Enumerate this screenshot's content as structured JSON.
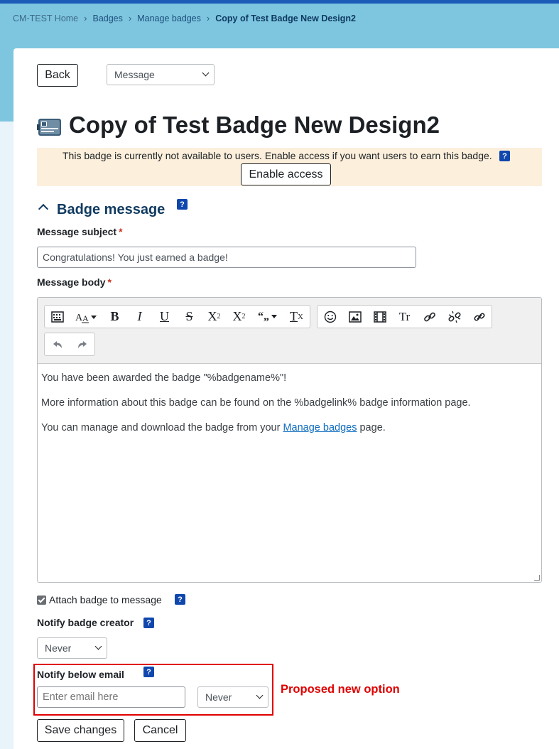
{
  "breadcrumb": {
    "home": "CM-TEST Home",
    "badges": "Badges",
    "manage": "Manage badges",
    "current": "Copy of Test Badge New Design2",
    "separator": "›"
  },
  "actions": {
    "back_label": "Back",
    "view_select": "Message"
  },
  "page": {
    "title": "Copy of Test Badge New Design2"
  },
  "notice": {
    "text": "This badge is currently not available to users. Enable access if you want users to earn this badge.",
    "enable_label": "Enable access"
  },
  "section": {
    "title": "Badge message"
  },
  "form": {
    "subject_label": "Message subject",
    "subject_value": "Congratulations! You just earned a badge!",
    "body_label": "Message body",
    "required_mark": "*",
    "help_mark": "?",
    "body_paragraph1": "You have been awarded the badge \"%badgename%\"!",
    "body_paragraph2": "More information about this badge can be found on the %badgelink% badge information page.",
    "body_paragraph3_prefix": "You can manage and download the badge from your ",
    "body_link": "Manage badges",
    "body_paragraph3_suffix": " page.",
    "attach_label": "Attach badge to message",
    "attach_checked": true,
    "notify_creator_label": "Notify badge creator",
    "notify_creator_value": "Never",
    "notify_email_label": "Notify below email",
    "email_placeholder": "Enter email here",
    "notify_email_value": "Never",
    "save_label": "Save changes",
    "cancel_label": "Cancel"
  },
  "toolbar": {
    "bold": "B",
    "italic": "I",
    "underline": "U",
    "strike": "S",
    "subscript_base": "X",
    "subscript": "2",
    "superscript_base": "X",
    "superscript": "2",
    "clear_base": "T",
    "clear_sub": "X",
    "lang": "Tr",
    "quote": "“„"
  },
  "annotation": {
    "text": "Proposed new option"
  },
  "colors": {
    "hero": "#7ec6e0",
    "topbar": "#1c5cb8",
    "notice_bg": "#fcefdc",
    "help_icon": "#0f47ad",
    "section_title": "#0f3a60",
    "annotation": "#e00000",
    "required": "#ca3120"
  }
}
